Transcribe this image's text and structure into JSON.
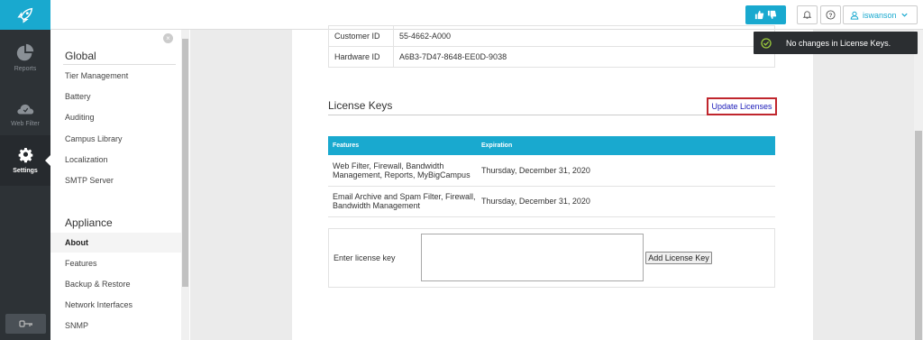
{
  "topbar": {
    "username": "iswanson"
  },
  "rail": {
    "items": [
      {
        "label": "Reports",
        "icon": "pie-chart-icon"
      },
      {
        "label": "Web Filter",
        "icon": "cloud-icon"
      },
      {
        "label": "Settings",
        "icon": "gear-icon"
      }
    ]
  },
  "nav": {
    "global_heading": "Global",
    "global_links": [
      "Tier Management",
      "Battery",
      "Auditing",
      "Campus Library",
      "Localization",
      "SMTP Server"
    ],
    "appliance_heading": "Appliance",
    "appliance_links": [
      "About",
      "Features",
      "Backup & Restore",
      "Network Interfaces",
      "SNMP"
    ],
    "active": "About"
  },
  "info": {
    "rows": [
      {
        "label": "Customer ID",
        "value": "55-4662-A000"
      },
      {
        "label": "Hardware ID",
        "value": "A6B3-7D47-8648-EE0D-9038"
      }
    ]
  },
  "license": {
    "title": "License Keys",
    "update_label": "Update Licenses",
    "headers": [
      "Features",
      "Expiration"
    ],
    "rows": [
      {
        "features": "Web Filter, Firewall, Bandwidth Management, Reports, MyBigCampus",
        "expiration": "Thursday, December 31, 2020"
      },
      {
        "features": "Email Archive and Spam Filter, Firewall, Bandwidth Management",
        "expiration": "Thursday, December 31, 2020"
      }
    ],
    "enter_label": "Enter license key",
    "key_value": "",
    "add_label": "Add License Key"
  },
  "toast": {
    "message": "No changes in License Keys."
  },
  "colors": {
    "accent": "#19a9cf",
    "rail_bg": "#2d3236",
    "highlight": "#c0262d"
  }
}
